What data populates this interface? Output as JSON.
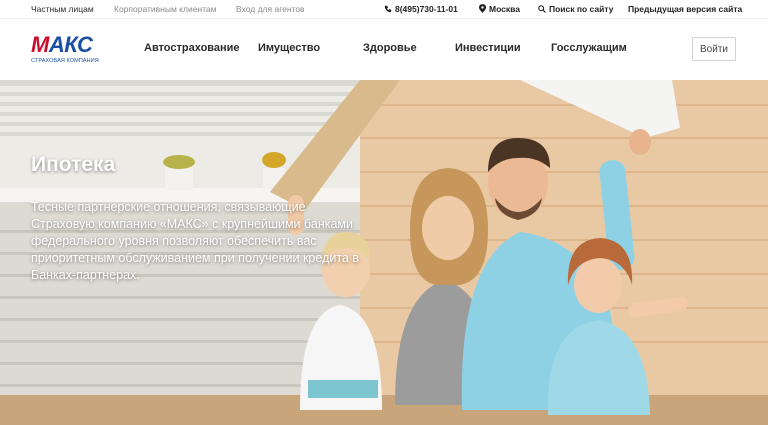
{
  "topbar": {
    "links": [
      "Частным лицам",
      "Корпоративным клиентам",
      "Вход для агентов"
    ],
    "phone": "8(495)730-11-01",
    "city": "Москва",
    "search": "Поиск по сайту",
    "prev_version": "Предыдущая версия сайта"
  },
  "logo": {
    "first_letter": "М",
    "rest": "АКС",
    "subtitle": "СТРАХОВАЯ КОМПАНИЯ"
  },
  "nav": {
    "items": [
      "Автострахование",
      "Имущество",
      "Здоровье",
      "Инвестиции",
      "Госслужащим"
    ],
    "login": "Войти"
  },
  "hero": {
    "title": "Ипотека",
    "description": "Тесные партнерские отношения, связывающие Страховую компанию «МАКС» с крупнейшими банками федерального уровня позволяют обеспечить вас приоритетным обслуживанием при получении кредита в Банках-партнерах."
  },
  "colors": {
    "brand_blue": "#1a4fa3",
    "brand_red": "#c8102e"
  }
}
